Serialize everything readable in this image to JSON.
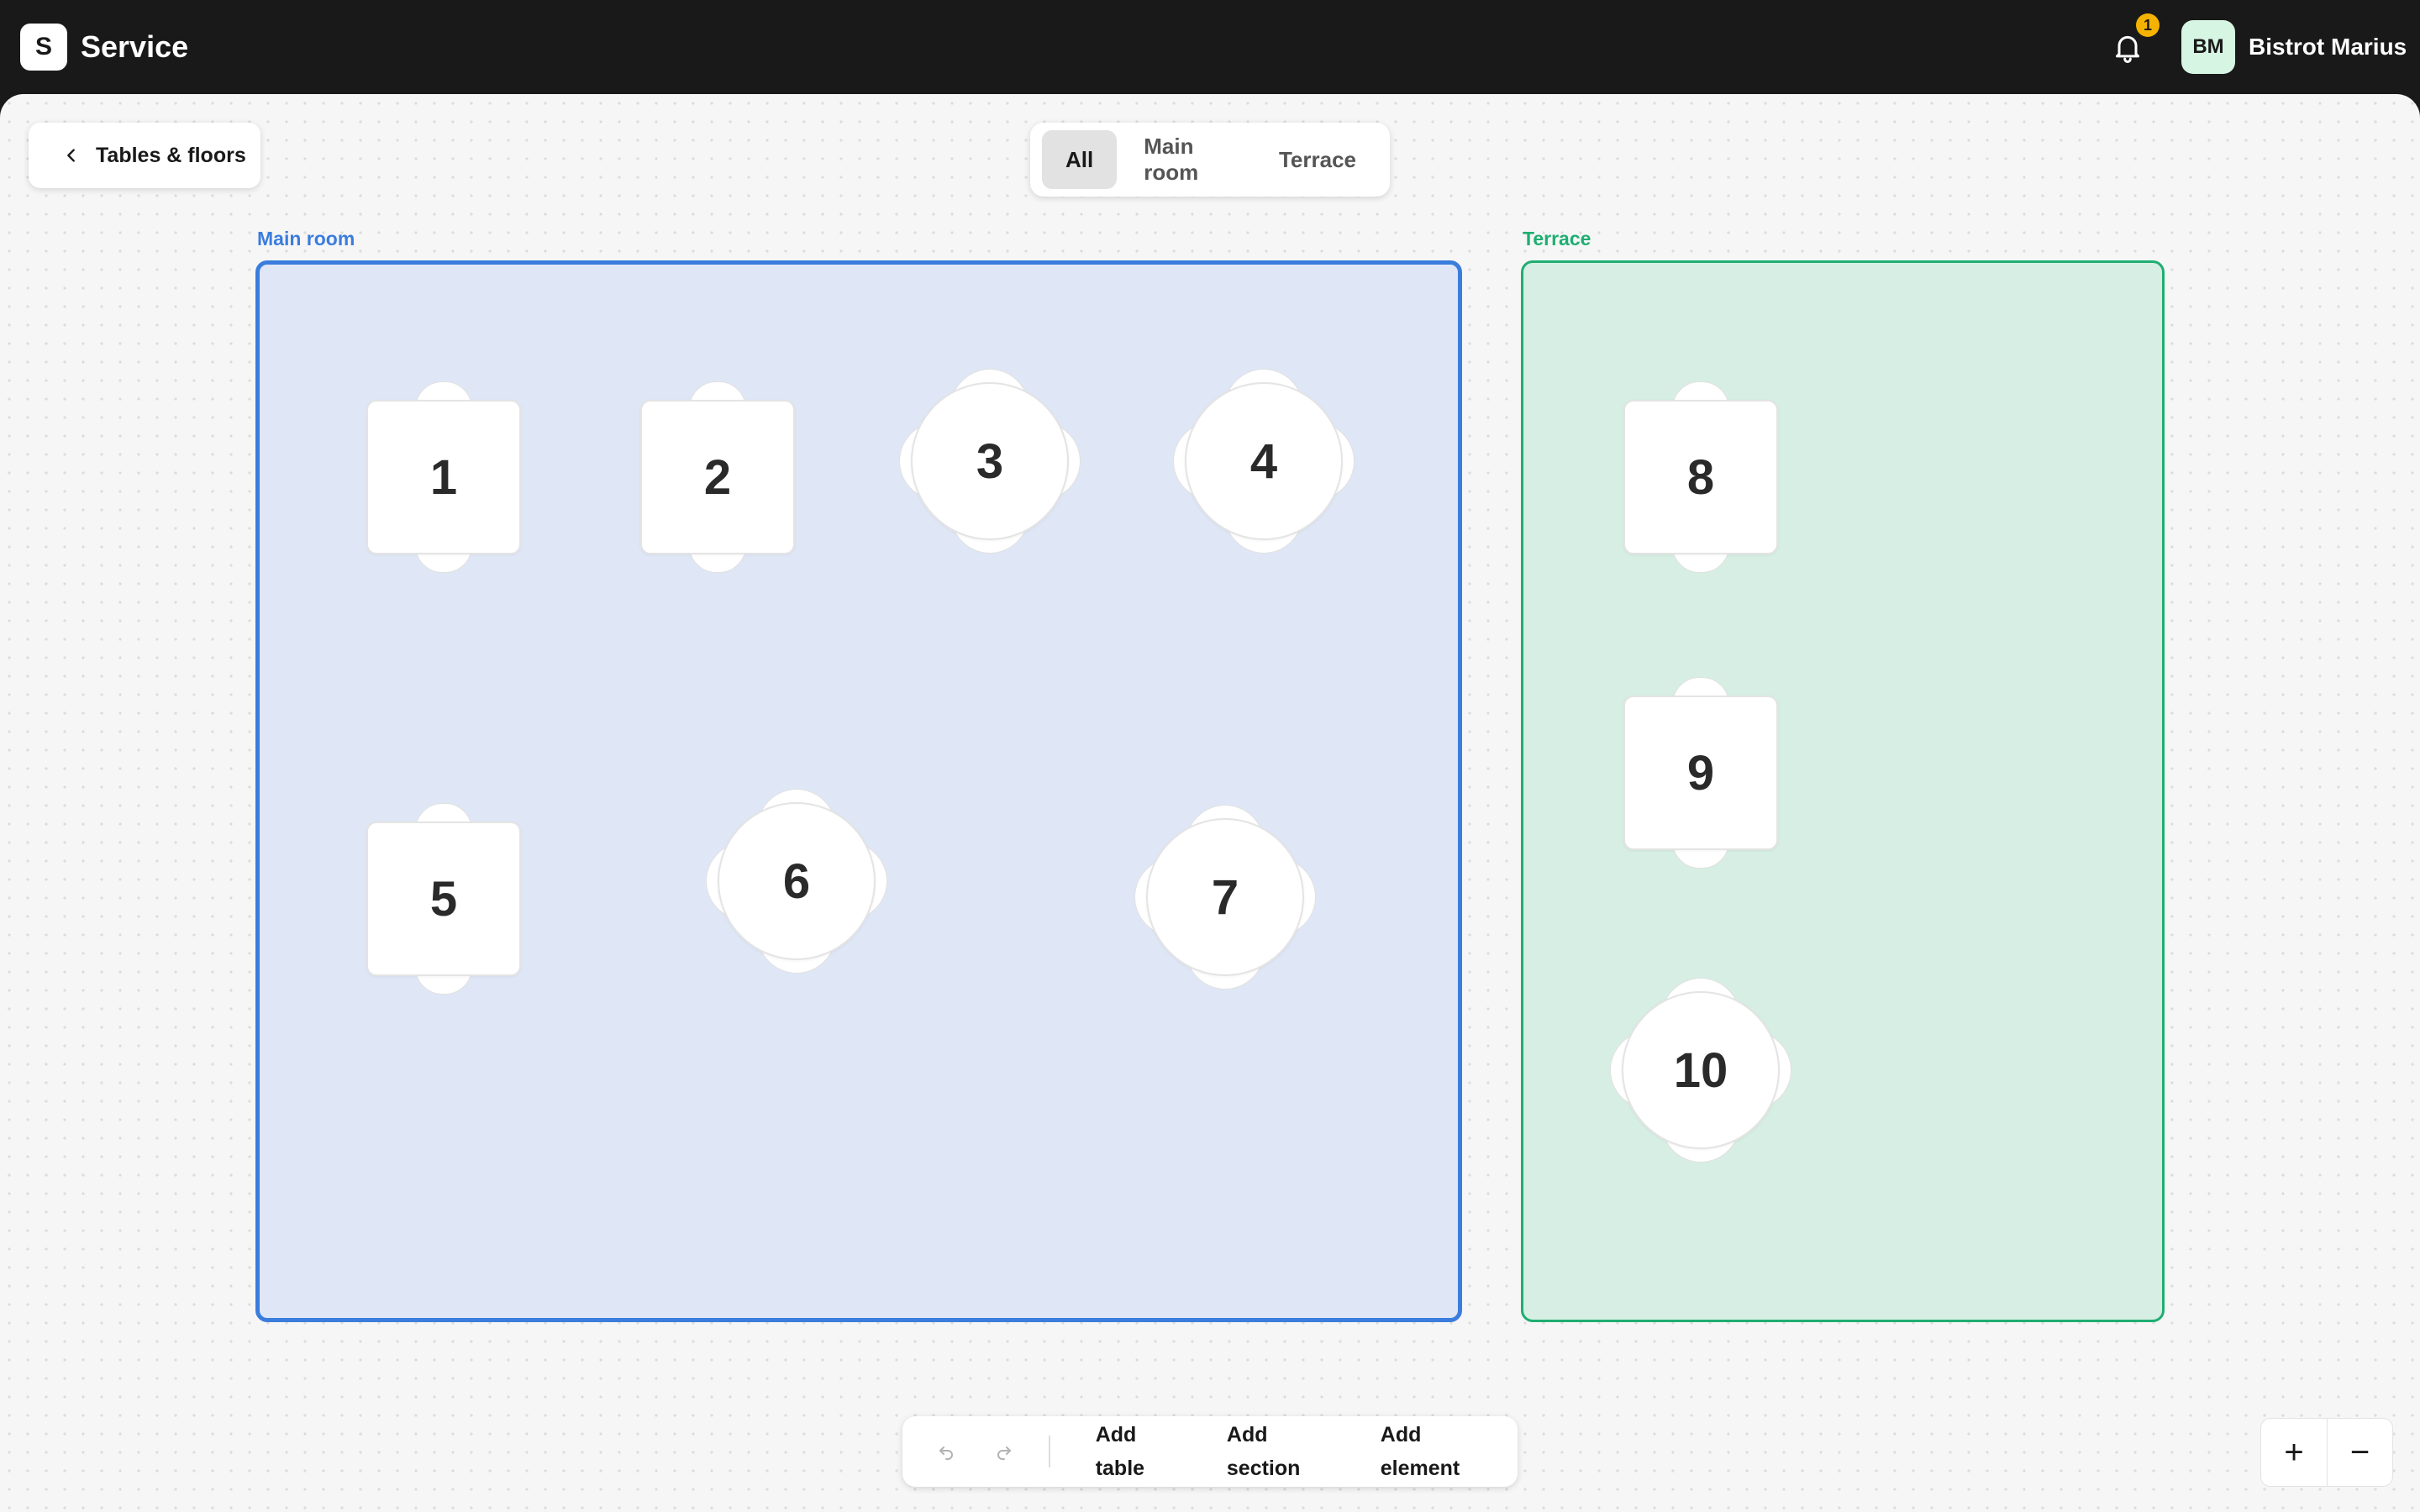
{
  "app": {
    "logo_letter": "S",
    "title": "Service"
  },
  "header": {
    "notification_count": "1",
    "avatar_initials": "BM",
    "user_name": "Bistrot Marius"
  },
  "back_button": {
    "label": "Tables & floors"
  },
  "filters": {
    "tabs": [
      "All",
      "Main room",
      "Terrace"
    ],
    "active": "All"
  },
  "sections": [
    {
      "name": "Main room",
      "color": "#3b7ddd",
      "fill": "#dfe7f6"
    },
    {
      "name": "Terrace",
      "color": "#1fae72",
      "fill": "#d6eee3"
    }
  ],
  "tables": [
    {
      "number": "1",
      "shape": "square",
      "section": "Main room"
    },
    {
      "number": "2",
      "shape": "square",
      "section": "Main room"
    },
    {
      "number": "3",
      "shape": "round",
      "section": "Main room"
    },
    {
      "number": "4",
      "shape": "round",
      "section": "Main room"
    },
    {
      "number": "5",
      "shape": "square",
      "section": "Main room"
    },
    {
      "number": "6",
      "shape": "round",
      "section": "Main room"
    },
    {
      "number": "7",
      "shape": "round",
      "section": "Main room"
    },
    {
      "number": "8",
      "shape": "square",
      "section": "Terrace"
    },
    {
      "number": "9",
      "shape": "square",
      "section": "Terrace"
    },
    {
      "number": "10",
      "shape": "round",
      "section": "Terrace"
    }
  ],
  "toolbar": {
    "undo_icon": "undo-icon",
    "redo_icon": "redo-icon",
    "add_table": "Add table",
    "add_section": "Add section",
    "add_element": "Add element"
  },
  "zoom": {
    "in_symbol": "+",
    "out_symbol": "−"
  }
}
